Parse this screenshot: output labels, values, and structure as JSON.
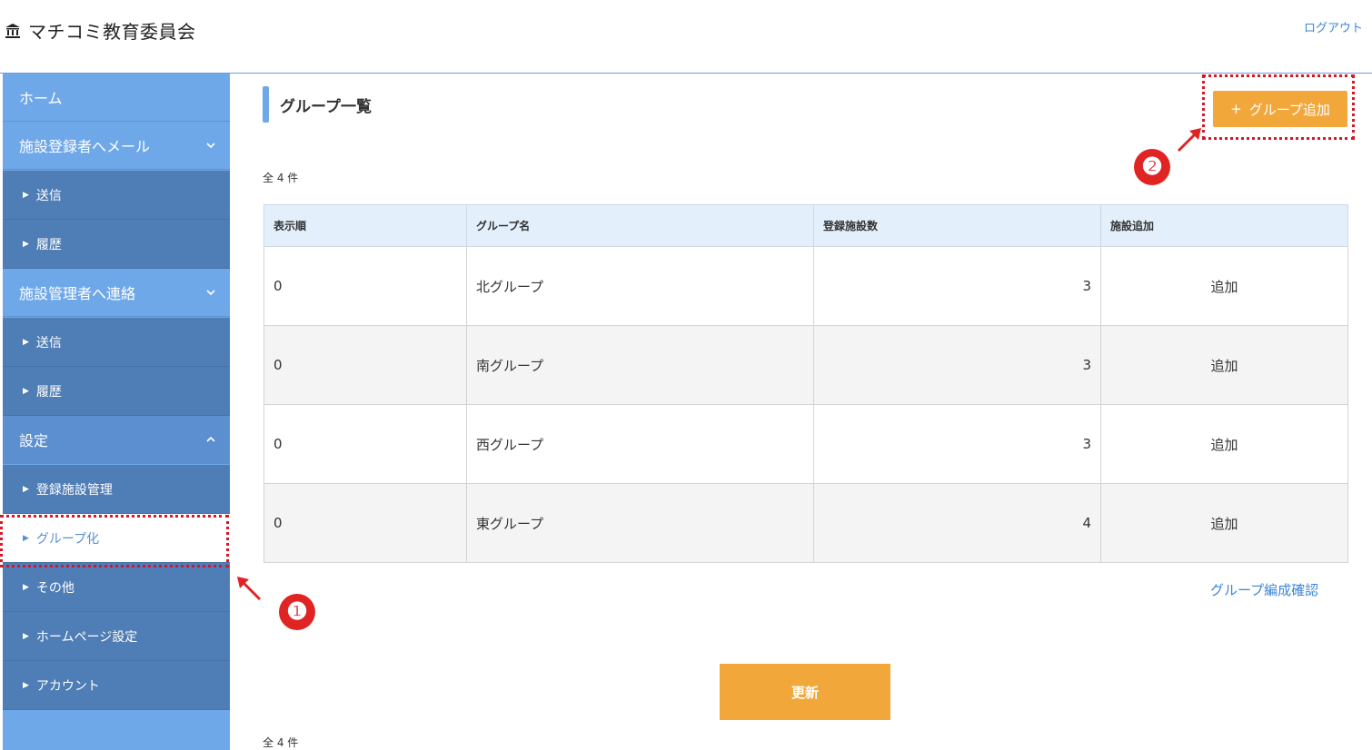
{
  "header": {
    "title": "マチコミ教育委員会",
    "logout_label": "ログアウト",
    "logo_icon": "building-icon"
  },
  "sidebar": {
    "home": "ホーム",
    "mail_to_registrants": {
      "label": "施設登録者へメール",
      "items": [
        "送信",
        "履歴"
      ]
    },
    "contact_admins": {
      "label": "施設管理者へ連絡",
      "items": [
        "送信",
        "履歴"
      ]
    },
    "settings": {
      "label": "設定",
      "items": [
        "登録施設管理",
        "グループ化",
        "その他",
        "ホームページ設定",
        "アカウント"
      ]
    }
  },
  "main": {
    "page_title": "グループ一覧",
    "add_group_button": "グループ追加",
    "count_top": "全 4 件",
    "count_bottom": "全 4 件",
    "table": {
      "headers": [
        "表示順",
        "グループ名",
        "登録施設数",
        "施設追加"
      ],
      "rows": [
        {
          "order": "0",
          "name": "北グループ",
          "facilities": "3",
          "action": "追加"
        },
        {
          "order": "0",
          "name": "南グループ",
          "facilities": "3",
          "action": "追加"
        },
        {
          "order": "0",
          "name": "西グループ",
          "facilities": "3",
          "action": "追加"
        },
        {
          "order": "0",
          "name": "東グループ",
          "facilities": "4",
          "action": "追加"
        }
      ]
    },
    "confirm_link": "グループ編成確認",
    "update_button": "更新"
  },
  "annotations": {
    "marker_1": "❶",
    "marker_2": "❷",
    "highlight_color": "#d8162a"
  },
  "colors": {
    "sidebar_main": "#6fa8e8",
    "sidebar_sub": "#4f7db5",
    "accent_orange": "#f2a73b",
    "link_blue": "#3a86d6"
  }
}
